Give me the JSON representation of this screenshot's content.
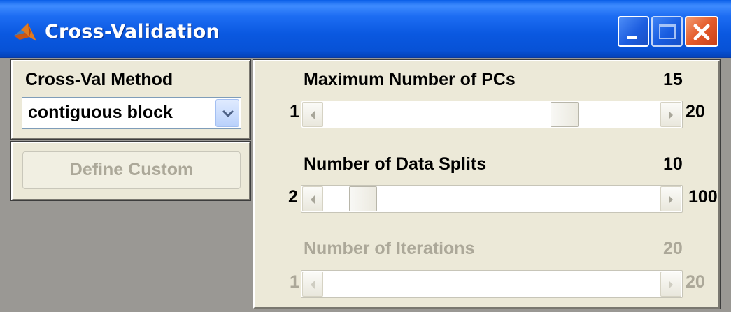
{
  "window": {
    "title": "Cross-Validation",
    "icon": "matlab-logo-icon",
    "controls": [
      "minimize-icon",
      "maximize-icon",
      "close-icon"
    ]
  },
  "method_panel": {
    "label": "Cross-Val Method",
    "dropdown_value": "contiguous block"
  },
  "custom_panel": {
    "button_label": "Define Custom",
    "enabled": false
  },
  "sliders": [
    {
      "title": "Maximum Number of PCs",
      "value": "15",
      "min": "1",
      "max": "20",
      "enabled": true,
      "level": 15
    },
    {
      "title": "Number of Data Splits",
      "value": "10",
      "min": "2",
      "max": "100",
      "enabled": true,
      "level": 10
    },
    {
      "title": "Number of Iterations",
      "value": "20",
      "min": "1",
      "max": "20",
      "enabled": false,
      "level": null
    }
  ],
  "colors": {
    "titlebar": "#0a58e0",
    "panel": "#ece9d8",
    "disabled_text": "#aca899"
  }
}
